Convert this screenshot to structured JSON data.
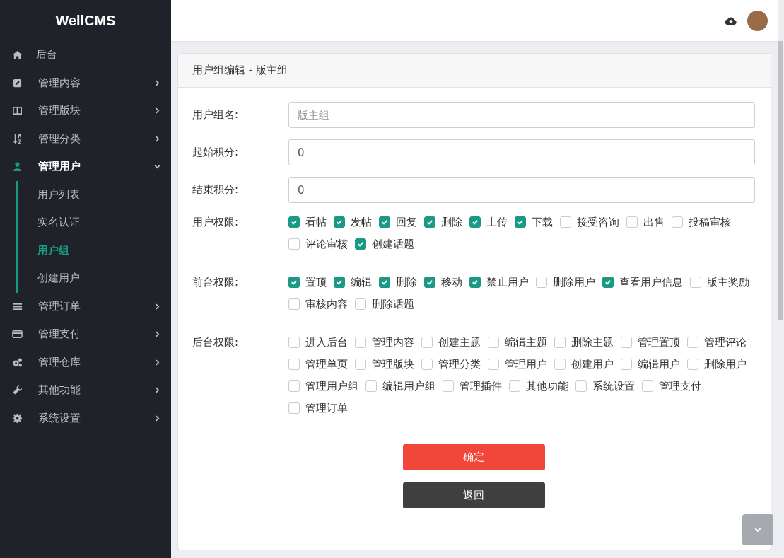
{
  "sidebar": {
    "logo": "WellCMS",
    "items": [
      {
        "label": "后台"
      },
      {
        "label": "管理内容",
        "expanded": false
      },
      {
        "label": "管理版块",
        "expanded": false
      },
      {
        "label": "管理分类",
        "expanded": false
      },
      {
        "label": "管理用户",
        "expanded": true,
        "children": [
          {
            "label": "用户列表",
            "selected": false
          },
          {
            "label": "实名认证",
            "selected": false
          },
          {
            "label": "用户组",
            "selected": true
          },
          {
            "label": "创建用户",
            "selected": false
          }
        ]
      },
      {
        "label": "管理订单",
        "expanded": false
      },
      {
        "label": "管理支付",
        "expanded": false
      },
      {
        "label": "管理仓库",
        "expanded": false
      },
      {
        "label": "其他功能",
        "expanded": false
      },
      {
        "label": "系统设置",
        "expanded": false
      }
    ]
  },
  "card": {
    "title": "用户组编辑 - 版主组",
    "fields": [
      {
        "label": "用户组名:",
        "placeholder": "版主组"
      },
      {
        "label": "起始积分:",
        "value": "0"
      },
      {
        "label": "结束积分:",
        "value": "0"
      }
    ],
    "permission_groups": [
      {
        "label": "用户权限:",
        "options": [
          {
            "label": "看帖",
            "checked": true
          },
          {
            "label": "发帖",
            "checked": true
          },
          {
            "label": "回复",
            "checked": true
          },
          {
            "label": "删除",
            "checked": true
          },
          {
            "label": "上传",
            "checked": true
          },
          {
            "label": "下载",
            "checked": true
          },
          {
            "label": "接受咨询",
            "checked": false
          },
          {
            "label": "出售",
            "checked": false
          },
          {
            "label": "投稿审核",
            "checked": false
          },
          {
            "label": "评论审核",
            "checked": false
          },
          {
            "label": "创建话题",
            "checked": true
          }
        ]
      },
      {
        "label": "前台权限:",
        "options": [
          {
            "label": "置顶",
            "checked": true
          },
          {
            "label": "编辑",
            "checked": true
          },
          {
            "label": "删除",
            "checked": true
          },
          {
            "label": "移动",
            "checked": true
          },
          {
            "label": "禁止用户",
            "checked": true
          },
          {
            "label": "删除用户",
            "checked": false
          },
          {
            "label": "查看用户信息",
            "checked": true
          },
          {
            "label": "版主奖励",
            "checked": false
          },
          {
            "label": "审核内容",
            "checked": false
          },
          {
            "label": "删除话题",
            "checked": false
          }
        ]
      },
      {
        "label": "后台权限:",
        "options": [
          {
            "label": "进入后台",
            "checked": false
          },
          {
            "label": "管理内容",
            "checked": false
          },
          {
            "label": "创建主题",
            "checked": false
          },
          {
            "label": "编辑主题",
            "checked": false
          },
          {
            "label": "删除主题",
            "checked": false
          },
          {
            "label": "管理置顶",
            "checked": false
          },
          {
            "label": "管理评论",
            "checked": false
          },
          {
            "label": "管理单页",
            "checked": false
          },
          {
            "label": "管理版块",
            "checked": false
          },
          {
            "label": "管理分类",
            "checked": false
          },
          {
            "label": "管理用户",
            "checked": false
          },
          {
            "label": "创建用户",
            "checked": false
          },
          {
            "label": "编辑用户",
            "checked": false
          },
          {
            "label": "删除用户",
            "checked": false
          },
          {
            "label": "管理用户组",
            "checked": false
          },
          {
            "label": "编辑用户组",
            "checked": false
          },
          {
            "label": "管理插件",
            "checked": false
          },
          {
            "label": "其他功能",
            "checked": false
          },
          {
            "label": "系统设置",
            "checked": false
          },
          {
            "label": "管理支付",
            "checked": false
          },
          {
            "label": "管理订单",
            "checked": false
          }
        ]
      }
    ],
    "buttons": [
      {
        "label": "确定",
        "kind": "primary"
      },
      {
        "label": "返回",
        "kind": "secondary"
      }
    ]
  }
}
